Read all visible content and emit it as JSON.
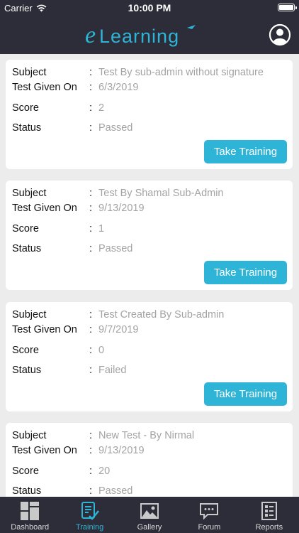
{
  "status_bar": {
    "carrier": "Carrier",
    "time": "10:00 PM"
  },
  "header": {
    "logo_text": "Learning",
    "logo_letter": "e"
  },
  "field_labels": {
    "subject": "Subject",
    "test_given_on": "Test Given On",
    "score": "Score",
    "status": "Status",
    "colon": ":"
  },
  "action_label": "Take Training",
  "tests": [
    {
      "subject": "Test By sub-admin without signature",
      "date": "6/3/2019",
      "score": "2",
      "status": "Passed"
    },
    {
      "subject": "Test By Shamal Sub-Admin",
      "date": "9/13/2019",
      "score": "1",
      "status": "Passed"
    },
    {
      "subject": "Test Created By Sub-admin",
      "date": "9/7/2019",
      "score": "0",
      "status": "Failed"
    },
    {
      "subject": "New Test - By Nirmal",
      "date": "9/13/2019",
      "score": "20",
      "status": "Passed"
    }
  ],
  "tabs": [
    {
      "label": "Dashboard",
      "icon": "dashboard-icon",
      "active": false
    },
    {
      "label": "Training",
      "icon": "training-icon",
      "active": true
    },
    {
      "label": "Gallery",
      "icon": "gallery-icon",
      "active": false
    },
    {
      "label": "Forum",
      "icon": "forum-icon",
      "active": false
    },
    {
      "label": "Reports",
      "icon": "reports-icon",
      "active": false
    }
  ],
  "colors": {
    "header": "#2c2d38",
    "accent": "#2db4d6",
    "value_text": "#a3a3a3"
  }
}
